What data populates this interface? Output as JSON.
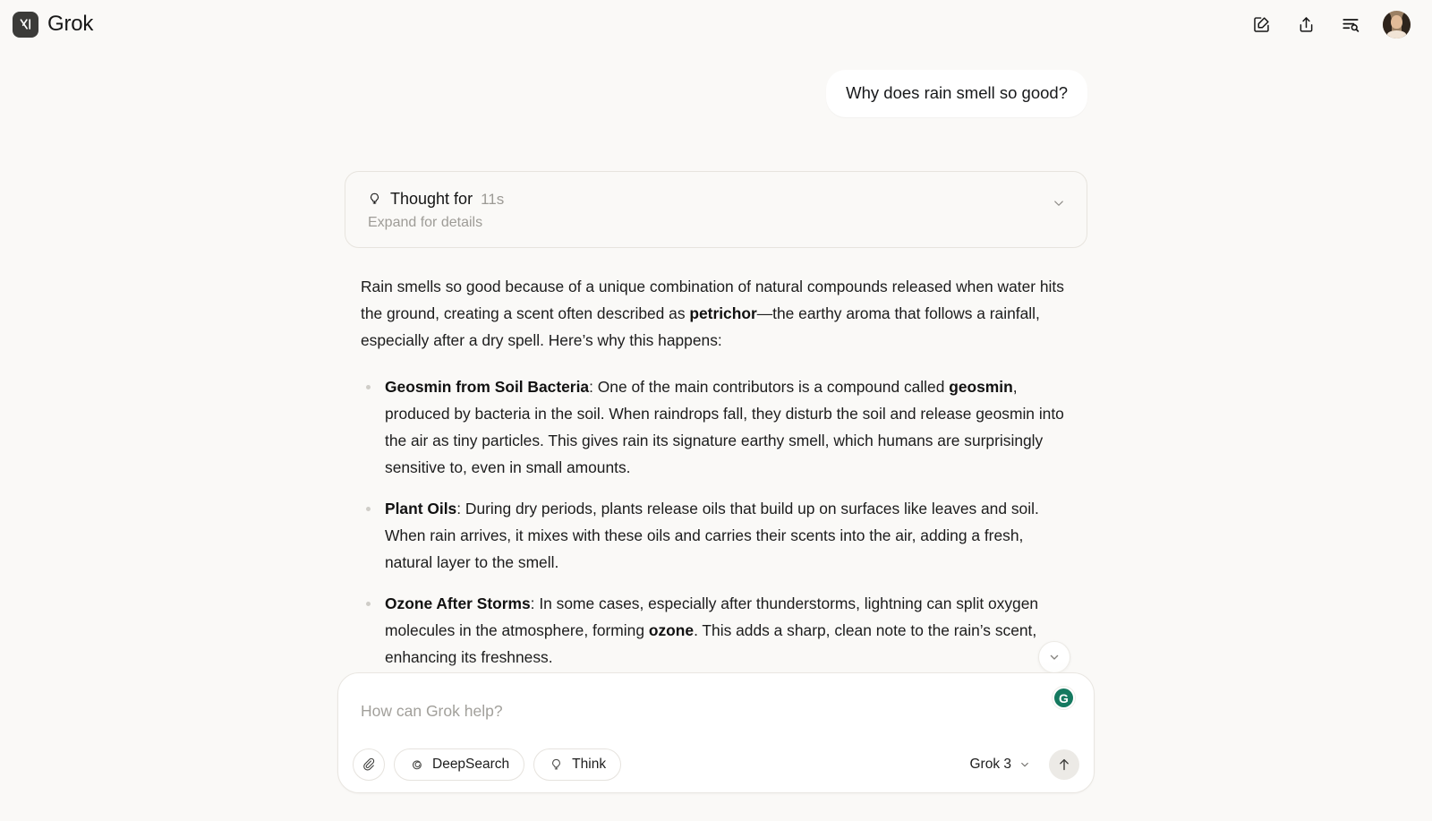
{
  "app": {
    "brand_name": "Grok",
    "logo_alt": "xai-logo"
  },
  "header": {
    "actions": [
      {
        "name": "new-chat",
        "icon": "compose-icon",
        "label": "New chat"
      },
      {
        "name": "share",
        "icon": "share-icon",
        "label": "Share"
      },
      {
        "name": "search-history",
        "icon": "search-history-icon",
        "label": "Search history"
      }
    ],
    "avatar_label": "User profile"
  },
  "conversation": {
    "user_message": "Why does rain smell so good?",
    "thinking": {
      "title": "Thought for",
      "duration": "11s",
      "subtitle": "Expand for details",
      "icon": "lightbulb-icon",
      "chevron": "chevron-down-icon"
    },
    "answer": {
      "intro_part1": "Rain smells so good because of a unique combination of natural compounds released when water hits the ground, creating a scent often described as ",
      "intro_bold": "petrichor",
      "intro_part2": "—the earthy aroma that follows a rainfall, especially after a dry spell. Here’s why this happens:",
      "bullets": [
        {
          "label": "Geosmin from Soil Bacteria",
          "text_part1": ": One of the main contributors is a compound called ",
          "inline_bold": "geosmin",
          "text_part2": ", produced by bacteria in the soil. When raindrops fall, they disturb the soil and release geosmin into the air as tiny particles. This gives rain its signature earthy smell, which humans are surprisingly sensitive to, even in small amounts."
        },
        {
          "label": "Plant Oils",
          "text_part1": ": During dry periods, plants release oils that build up on surfaces like leaves and soil. When rain arrives, it mixes with these oils and carries their scents into the air, adding a fresh, natural layer to the smell.",
          "inline_bold": "",
          "text_part2": ""
        },
        {
          "label": "Ozone After Storms",
          "text_part1": ": In some cases, especially after thunderstorms, lightning can split oxygen molecules in the atmosphere, forming ",
          "inline_bold": "ozone",
          "text_part2": ". This adds a sharp, clean note to the rain’s scent, enhancing its freshness."
        }
      ]
    },
    "scroll_to_bottom_icon": "chevron-down-icon"
  },
  "composer": {
    "placeholder": "How can Grok help?",
    "value": "",
    "grammarly_badge": "G",
    "attach_icon": "paperclip-icon",
    "tools": [
      {
        "label": "DeepSearch",
        "icon": "deepsearch-icon"
      },
      {
        "label": "Think",
        "icon": "lightbulb-icon"
      }
    ],
    "model": "Grok 3",
    "model_chevron": "chevron-down-icon",
    "send_icon": "arrow-up-icon"
  },
  "colors": {
    "background": "#faf9f7",
    "surface": "#ffffff",
    "border": "#e8e5e0",
    "text": "#1b1b1b",
    "muted": "#9c9a95",
    "grammarly_green": "#15795f"
  }
}
